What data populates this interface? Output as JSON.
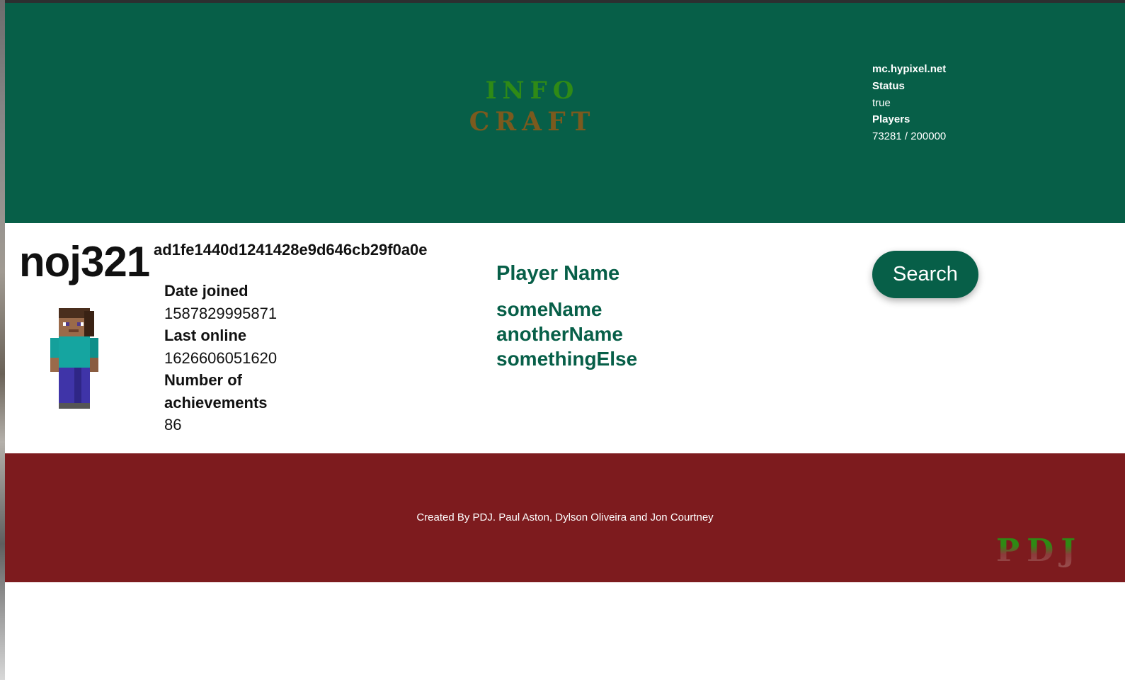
{
  "header": {
    "logo": {
      "line1": "INFO",
      "line2": "CRAFT"
    },
    "server": {
      "host": "mc.hypixel.net",
      "status_label": "Status",
      "status_value": "true",
      "players_label": "Players",
      "players_value": "73281 / 200000"
    }
  },
  "player": {
    "username": "noj321",
    "uuid": "ad1fe1440d1241428e9d646cb29f0a0e",
    "date_joined_label": "Date joined",
    "date_joined_value": "1587829995871",
    "last_online_label": "Last online",
    "last_online_value": "1626606051620",
    "achievements_label": "Number of achievements",
    "achievements_value": "86"
  },
  "names": {
    "header": "Player Name",
    "items": [
      "someName",
      "anotherName",
      "somethingElse"
    ]
  },
  "search": {
    "label": "Search"
  },
  "footer": {
    "credits": "Created By PDJ. Paul Aston, Dylson Oliveira and Jon Courtney",
    "logo": "PDJ"
  },
  "colors": {
    "header_bg": "#075f48",
    "footer_bg": "#7d1b1e",
    "accent": "#075f48"
  }
}
